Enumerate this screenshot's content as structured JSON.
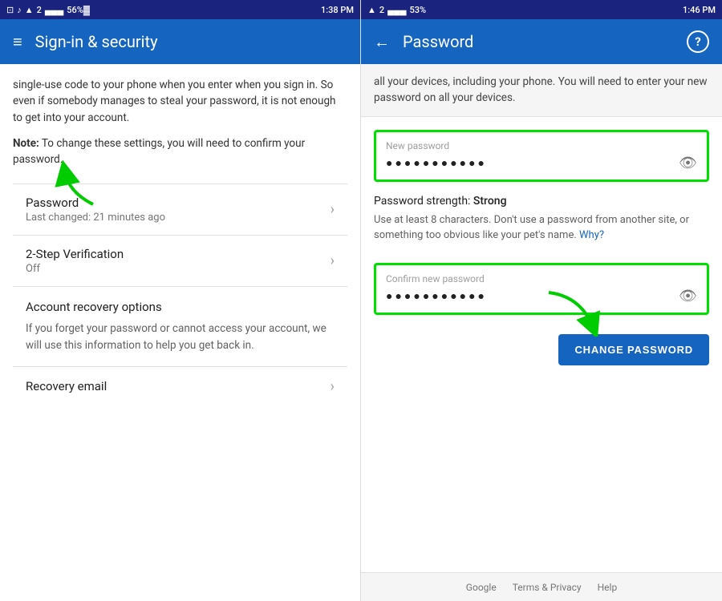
{
  "left_panel": {
    "status_bar": {
      "left": "≡ ⊡ ♪",
      "time": "1:38 PM",
      "right": "▲ ⊡ ▄▄▄ 56%",
      "network": "2"
    },
    "header": {
      "menu_icon": "≡",
      "title": "Sign-in & security"
    },
    "intro_text": "single-use code to your phone when you enter when you sign in. So even if somebody manages to steal your password, it is not enough to get into your account.",
    "note_text_bold": "Note:",
    "note_text": " To change these settings, you will need to confirm your password.",
    "items": [
      {
        "title": "Password",
        "subtitle": "Last changed: 21 minutes ago"
      },
      {
        "title": "2-Step Verification",
        "subtitle": "Off"
      }
    ],
    "account_recovery": {
      "heading": "Account recovery options",
      "text": "If you forget your password or cannot access your account, we will use this information to help you get back in."
    },
    "recovery_email_label": "Recovery email"
  },
  "right_panel": {
    "status_bar": {
      "time": "1:46 PM",
      "right": "53%",
      "network": "2"
    },
    "header": {
      "back_icon": "←",
      "title": "Password",
      "help_icon": "?"
    },
    "info_text": "all your devices, including your phone. You will need to enter your new password on all your devices.",
    "new_password": {
      "label": "New password",
      "dots": "●●●●●●●●●●●",
      "eye": "👁"
    },
    "strength": {
      "label": "Password strength:",
      "value": "Strong",
      "hint": "Use at least 8 characters. Don't use a password from another site, or something too obvious like your pet's name.",
      "why_link": "Why?"
    },
    "confirm_password": {
      "label": "Confirm new password",
      "dots": "●●●●●●●●●●●",
      "eye": "👁"
    },
    "change_button": "CHANGE PASSWORD",
    "footer": {
      "links": [
        "Google",
        "Terms & Privacy",
        "Help"
      ]
    }
  }
}
